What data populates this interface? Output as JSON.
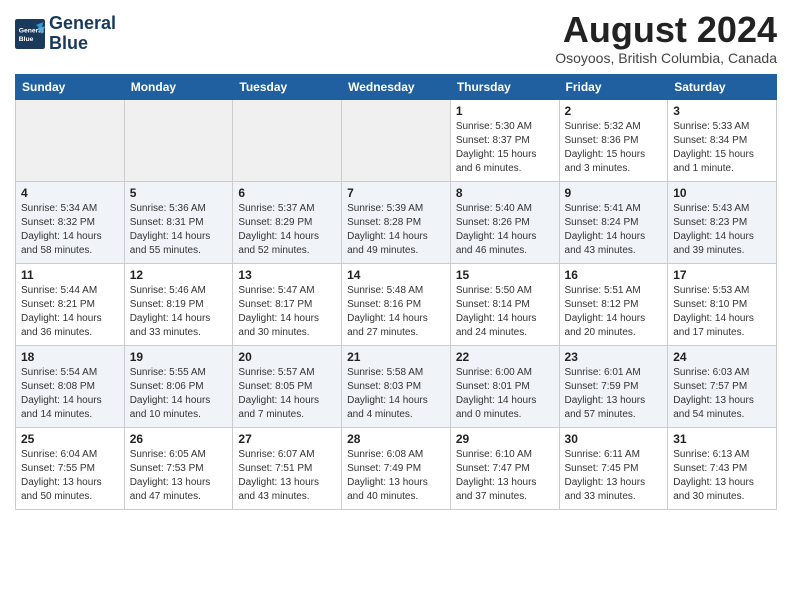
{
  "header": {
    "logo_line1": "General",
    "logo_line2": "Blue",
    "month_year": "August 2024",
    "location": "Osoyoos, British Columbia, Canada"
  },
  "days_of_week": [
    "Sunday",
    "Monday",
    "Tuesday",
    "Wednesday",
    "Thursday",
    "Friday",
    "Saturday"
  ],
  "weeks": [
    [
      {
        "day": "",
        "detail": ""
      },
      {
        "day": "",
        "detail": ""
      },
      {
        "day": "",
        "detail": ""
      },
      {
        "day": "",
        "detail": ""
      },
      {
        "day": "1",
        "detail": "Sunrise: 5:30 AM\nSunset: 8:37 PM\nDaylight: 15 hours\nand 6 minutes."
      },
      {
        "day": "2",
        "detail": "Sunrise: 5:32 AM\nSunset: 8:36 PM\nDaylight: 15 hours\nand 3 minutes."
      },
      {
        "day": "3",
        "detail": "Sunrise: 5:33 AM\nSunset: 8:34 PM\nDaylight: 15 hours\nand 1 minute."
      }
    ],
    [
      {
        "day": "4",
        "detail": "Sunrise: 5:34 AM\nSunset: 8:32 PM\nDaylight: 14 hours\nand 58 minutes."
      },
      {
        "day": "5",
        "detail": "Sunrise: 5:36 AM\nSunset: 8:31 PM\nDaylight: 14 hours\nand 55 minutes."
      },
      {
        "day": "6",
        "detail": "Sunrise: 5:37 AM\nSunset: 8:29 PM\nDaylight: 14 hours\nand 52 minutes."
      },
      {
        "day": "7",
        "detail": "Sunrise: 5:39 AM\nSunset: 8:28 PM\nDaylight: 14 hours\nand 49 minutes."
      },
      {
        "day": "8",
        "detail": "Sunrise: 5:40 AM\nSunset: 8:26 PM\nDaylight: 14 hours\nand 46 minutes."
      },
      {
        "day": "9",
        "detail": "Sunrise: 5:41 AM\nSunset: 8:24 PM\nDaylight: 14 hours\nand 43 minutes."
      },
      {
        "day": "10",
        "detail": "Sunrise: 5:43 AM\nSunset: 8:23 PM\nDaylight: 14 hours\nand 39 minutes."
      }
    ],
    [
      {
        "day": "11",
        "detail": "Sunrise: 5:44 AM\nSunset: 8:21 PM\nDaylight: 14 hours\nand 36 minutes."
      },
      {
        "day": "12",
        "detail": "Sunrise: 5:46 AM\nSunset: 8:19 PM\nDaylight: 14 hours\nand 33 minutes."
      },
      {
        "day": "13",
        "detail": "Sunrise: 5:47 AM\nSunset: 8:17 PM\nDaylight: 14 hours\nand 30 minutes."
      },
      {
        "day": "14",
        "detail": "Sunrise: 5:48 AM\nSunset: 8:16 PM\nDaylight: 14 hours\nand 27 minutes."
      },
      {
        "day": "15",
        "detail": "Sunrise: 5:50 AM\nSunset: 8:14 PM\nDaylight: 14 hours\nand 24 minutes."
      },
      {
        "day": "16",
        "detail": "Sunrise: 5:51 AM\nSunset: 8:12 PM\nDaylight: 14 hours\nand 20 minutes."
      },
      {
        "day": "17",
        "detail": "Sunrise: 5:53 AM\nSunset: 8:10 PM\nDaylight: 14 hours\nand 17 minutes."
      }
    ],
    [
      {
        "day": "18",
        "detail": "Sunrise: 5:54 AM\nSunset: 8:08 PM\nDaylight: 14 hours\nand 14 minutes."
      },
      {
        "day": "19",
        "detail": "Sunrise: 5:55 AM\nSunset: 8:06 PM\nDaylight: 14 hours\nand 10 minutes."
      },
      {
        "day": "20",
        "detail": "Sunrise: 5:57 AM\nSunset: 8:05 PM\nDaylight: 14 hours\nand 7 minutes."
      },
      {
        "day": "21",
        "detail": "Sunrise: 5:58 AM\nSunset: 8:03 PM\nDaylight: 14 hours\nand 4 minutes."
      },
      {
        "day": "22",
        "detail": "Sunrise: 6:00 AM\nSunset: 8:01 PM\nDaylight: 14 hours\nand 0 minutes."
      },
      {
        "day": "23",
        "detail": "Sunrise: 6:01 AM\nSunset: 7:59 PM\nDaylight: 13 hours\nand 57 minutes."
      },
      {
        "day": "24",
        "detail": "Sunrise: 6:03 AM\nSunset: 7:57 PM\nDaylight: 13 hours\nand 54 minutes."
      }
    ],
    [
      {
        "day": "25",
        "detail": "Sunrise: 6:04 AM\nSunset: 7:55 PM\nDaylight: 13 hours\nand 50 minutes."
      },
      {
        "day": "26",
        "detail": "Sunrise: 6:05 AM\nSunset: 7:53 PM\nDaylight: 13 hours\nand 47 minutes."
      },
      {
        "day": "27",
        "detail": "Sunrise: 6:07 AM\nSunset: 7:51 PM\nDaylight: 13 hours\nand 43 minutes."
      },
      {
        "day": "28",
        "detail": "Sunrise: 6:08 AM\nSunset: 7:49 PM\nDaylight: 13 hours\nand 40 minutes."
      },
      {
        "day": "29",
        "detail": "Sunrise: 6:10 AM\nSunset: 7:47 PM\nDaylight: 13 hours\nand 37 minutes."
      },
      {
        "day": "30",
        "detail": "Sunrise: 6:11 AM\nSunset: 7:45 PM\nDaylight: 13 hours\nand 33 minutes."
      },
      {
        "day": "31",
        "detail": "Sunrise: 6:13 AM\nSunset: 7:43 PM\nDaylight: 13 hours\nand 30 minutes."
      }
    ]
  ]
}
